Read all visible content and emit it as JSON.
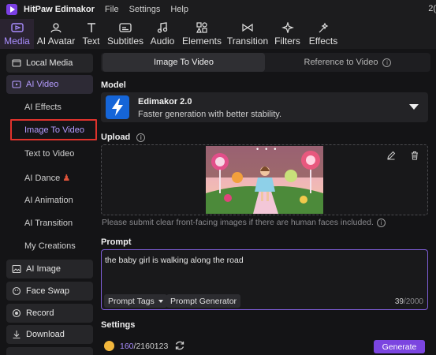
{
  "window": {
    "app_name": "HitPaw Edimakor",
    "menus": [
      "File",
      "Settings",
      "Help"
    ],
    "right_text": "2("
  },
  "toolbar": [
    {
      "label": "Media",
      "icon": "media-icon",
      "active": true
    },
    {
      "label": "AI Avatar",
      "icon": "ai-avatar-icon",
      "active": false
    },
    {
      "label": "Text",
      "icon": "text-icon",
      "active": false
    },
    {
      "label": "Subtitles",
      "icon": "subtitles-icon",
      "active": false
    },
    {
      "label": "Audio",
      "icon": "audio-icon",
      "active": false
    },
    {
      "label": "Elements",
      "icon": "elements-icon",
      "active": false
    },
    {
      "label": "Transition",
      "icon": "transition-icon",
      "active": false
    },
    {
      "label": "Filters",
      "icon": "filters-icon",
      "active": false
    },
    {
      "label": "Effects",
      "icon": "effects-icon",
      "active": false
    }
  ],
  "sidebar": {
    "local_media": "Local Media",
    "ai_video": "AI Video",
    "ai_video_sub": [
      "AI Effects",
      "Image To Video",
      "Text to Video",
      "AI Dance",
      "AI Animation",
      "AI Transition",
      "My Creations"
    ],
    "selected_sub": "Image To Video",
    "ai_image": "AI Image",
    "face_swap": "Face Swap",
    "record": "Record",
    "download": "Download"
  },
  "main": {
    "tabs": [
      "Image To Video",
      "Reference to Video"
    ],
    "model_label": "Model",
    "model_name": "Edimakor 2.0",
    "model_desc": "Faster generation with better stability.",
    "upload_label": "Upload",
    "upload_hint": "Please submit clear front-facing images if there are human faces included.",
    "prompt_label": "Prompt",
    "prompt_text": "the baby girl is walking along the road",
    "prompt_tags": "Prompt Tags",
    "prompt_generator": "Prompt Generator",
    "char_count": "39",
    "char_max": "/2000",
    "settings_label": "Settings",
    "credits_used": "160",
    "credits_total": "/2160123",
    "generate": "Generate"
  },
  "colors": {
    "accent": "#7b45e0",
    "selected_text": "#b59cff",
    "highlight_box": "#e0332c",
    "model_icon_bg": "#1565d8"
  }
}
